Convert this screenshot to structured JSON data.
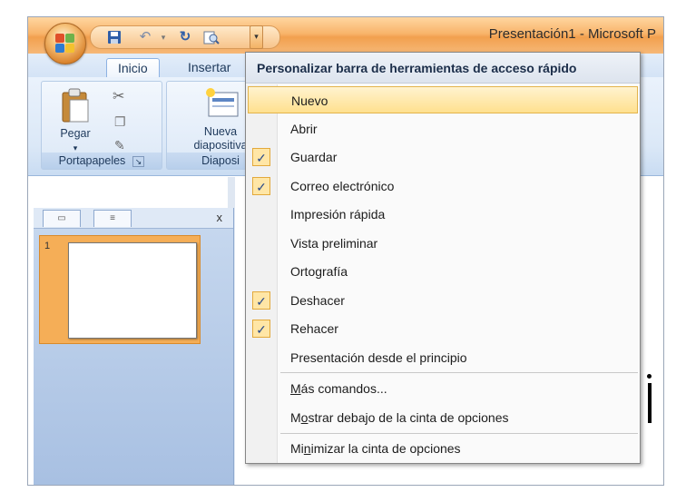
{
  "window": {
    "title": "Presentación1 - Microsoft P"
  },
  "quick_access": {
    "icons": [
      "save-icon",
      "undo-icon",
      "redo-icon",
      "print-preview-icon"
    ],
    "dropdown_glyph": "▾"
  },
  "tabs": [
    {
      "label": "Inicio",
      "active": true
    },
    {
      "label": "Insertar",
      "active": false
    }
  ],
  "ribbon": {
    "paste_label": "Pegar",
    "clipboard_group": "Portapapeles",
    "new_slide_label_1": "Nueva",
    "new_slide_label_2": "diapositiva",
    "slides_group": "Diaposi"
  },
  "slide_panel": {
    "close_glyph": "x",
    "thumb_number": "1"
  },
  "menu": {
    "header": "Personalizar barra de herramientas de acceso rápido",
    "items": [
      {
        "label": "Nuevo",
        "checked": false,
        "highlighted": true
      },
      {
        "label": "Abrir",
        "checked": false
      },
      {
        "label": "Guardar",
        "checked": true
      },
      {
        "label": "Correo electrónico",
        "checked": true
      },
      {
        "label": "Impresión rápida",
        "checked": false
      },
      {
        "label": "Vista preliminar",
        "checked": false
      },
      {
        "label": "Ortografía",
        "checked": false
      },
      {
        "label": "Deshacer",
        "checked": true
      },
      {
        "label": "Rehacer",
        "checked": true
      },
      {
        "label": "Presentación desde el principio",
        "checked": false
      }
    ],
    "more_commands": {
      "pre": "",
      "u": "M",
      "post": "ás comandos..."
    },
    "show_below": {
      "pre": "M",
      "u": "o",
      "post": "strar debajo de la cinta de opciones"
    },
    "minimize": {
      "pre": "Mi",
      "u": "n",
      "post": "imizar la cinta de opciones"
    },
    "check_glyph": "✓"
  },
  "colors": {
    "accent_orange": "#f2a04e",
    "highlight": "#ffe08e",
    "ribbon_blue": "#dbe8f7"
  }
}
